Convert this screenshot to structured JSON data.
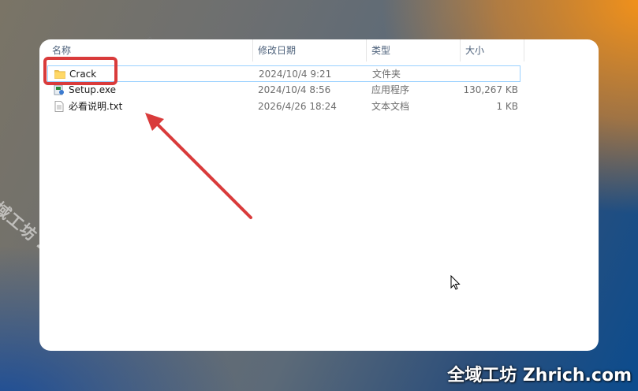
{
  "columns": {
    "name": "名称",
    "date": "修改日期",
    "type": "类型",
    "size": "大小"
  },
  "files": [
    {
      "name": "Crack",
      "date": "2024/10/4 9:21",
      "type": "文件夹",
      "size": "",
      "icon": "folder-icon",
      "selected": true
    },
    {
      "name": "Setup.exe",
      "date": "2024/10/4 8:56",
      "type": "应用程序",
      "size": "130,267 KB",
      "icon": "setup-exe-icon"
    },
    {
      "name": "必看说明.txt",
      "date": "2026/4/26 18:24",
      "type": "文本文档",
      "size": "1 KB",
      "icon": "text-document-icon"
    }
  ],
  "watermark": {
    "diagonal": "全域工坊 zhrich.com",
    "corner": "全域工坊 Zhrich.com"
  },
  "colors": {
    "highlight_box": "#d93b3b",
    "arrow": "#d93b3b",
    "selection_border": "#99d1ff"
  }
}
